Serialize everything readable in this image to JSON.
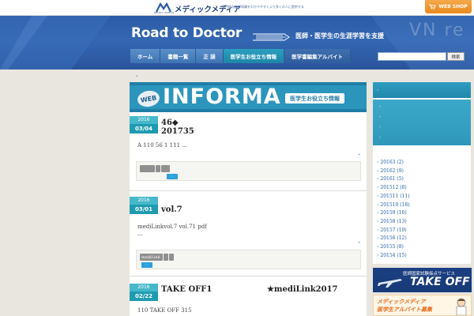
{
  "topbar": {
    "brand_sub": "MEDIC MEDIA",
    "brand_name": "メディックメディア",
    "tagline": "専門的な医学知識をわかりやすくより多くの人に提供する",
    "webshop_label": "WEB SHOP"
  },
  "header": {
    "logo_text": "Road to Doctor",
    "tagline": "医師・医学生の生涯学習を支援",
    "bg_text": "VN re",
    "accent": "#2c5ba6"
  },
  "nav": {
    "items": [
      "ホーム",
      "書籍一覧",
      "正 誤",
      "医学生お役立ち情報",
      "医学書編集アルバイト"
    ],
    "active_index": 3
  },
  "search": {
    "button_label": "検索",
    "placeholder": ""
  },
  "breadcrumb": {
    "arrow": "›"
  },
  "banner": {
    "web_label": "WEB",
    "title": "INFORMA",
    "subtitle": "医学生お役立ち情報"
  },
  "posts": [
    {
      "year": "2016",
      "date": "03/04",
      "title_line1": "46◆",
      "title_line2": "201735",
      "excerpt_line1": "A 110 56 1 111 ...",
      "excerpt_line2": "",
      "more": "»",
      "tags": [
        "",
        "",
        ""
      ],
      "tweet": "🐦"
    },
    {
      "year": "2016",
      "date": "03/01",
      "title_line1": "vol.7",
      "title_line2": "",
      "excerpt_line1": "mediLinkvol.7 vol.71 pdf",
      "excerpt_line2": "...",
      "more": "»",
      "tags": [
        "mediLink",
        "",
        ""
      ],
      "tweet": "🐦"
    },
    {
      "year": "2016",
      "date": "02/22",
      "title_line1": "TAKE OFF1                    ★mediLink2017",
      "title_line2": "",
      "excerpt_line1": "110 TAKE OFF 315",
      "excerpt_line2": "",
      "more": "",
      "tags": [],
      "tweet": ""
    }
  ],
  "sidebar": {
    "head_arrow": "›",
    "cats": [
      "›",
      "›",
      "›",
      "›"
    ],
    "archives": [
      "20163 (2)",
      "20162 (9)",
      "20161 (5)",
      "201512 (8)",
      "201511 (11)",
      "201510 (18)",
      "20159 (10)",
      "20158 (13)",
      "20157 (19)",
      "20156 (12)",
      "20155 (8)",
      "20154 (15)"
    ]
  },
  "side_banners": {
    "takeoff_sub": "医師国家試験採点サービス",
    "takeoff_title": "TAKE OFF",
    "recruit_line1": "メディックメディア",
    "recruit_line2": "医学生アルバイト募集"
  }
}
